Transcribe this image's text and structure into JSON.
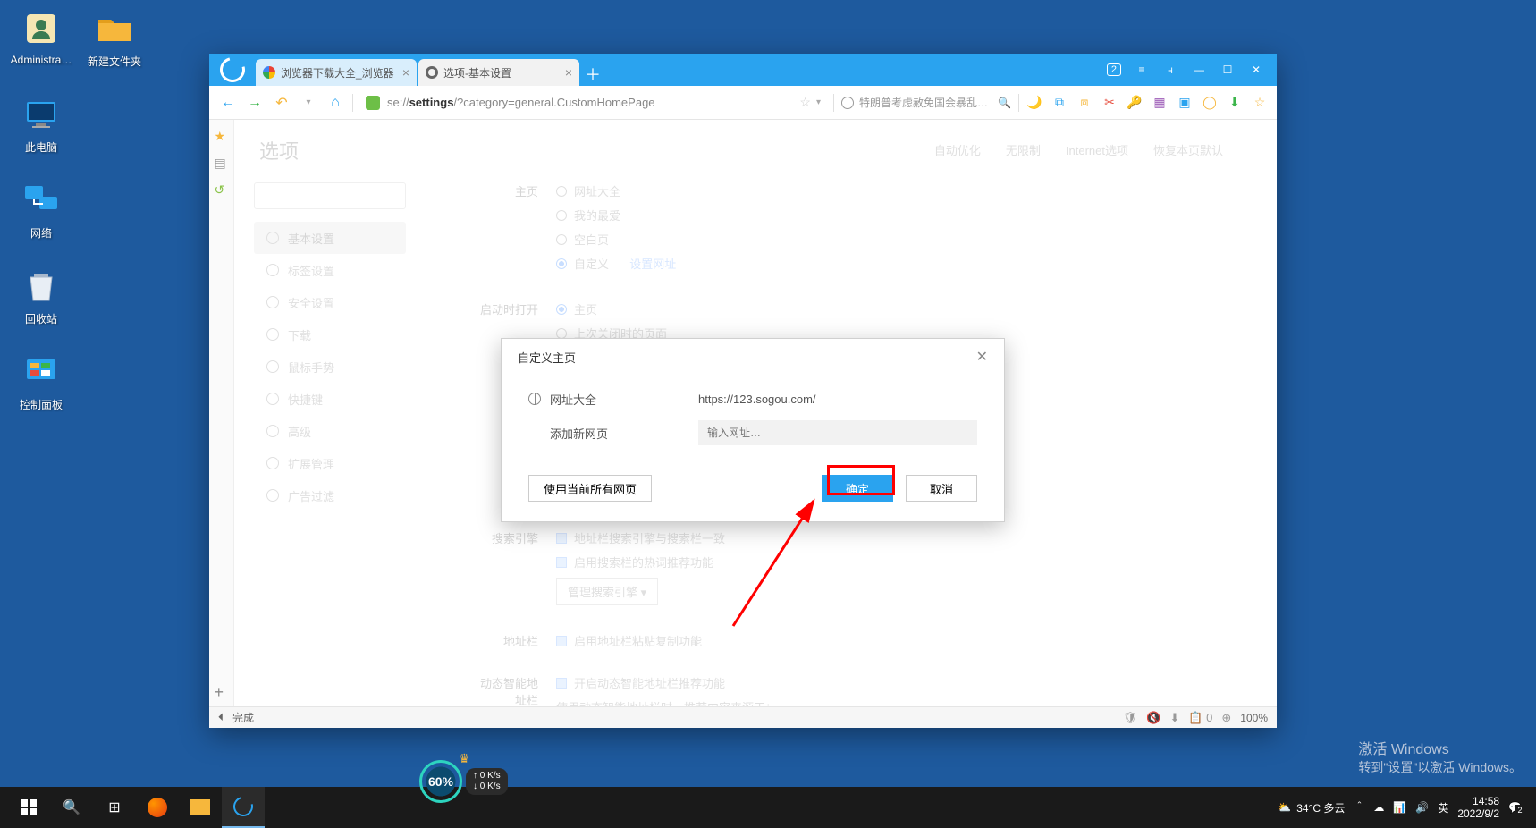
{
  "desktop": {
    "icons": [
      {
        "label": "Administra…",
        "type": "user"
      },
      {
        "label": "新建文件夹",
        "type": "folder"
      },
      {
        "label": "此电脑",
        "type": "pc"
      },
      {
        "label": "网络",
        "type": "network"
      },
      {
        "label": "回收站",
        "type": "recycle"
      },
      {
        "label": "控制面板",
        "type": "control"
      }
    ]
  },
  "browser": {
    "tabs": [
      {
        "title": "浏览器下载大全_浏览器",
        "active": false
      },
      {
        "title": "选项-基本设置",
        "active": true
      }
    ],
    "tab_new_glyph": "＋",
    "win": {
      "count": "2",
      "menu": "≡",
      "ext": "⫞",
      "min": "—",
      "max": "☐",
      "close": "✕"
    },
    "toolbar": {
      "back": "←",
      "fwd": "→",
      "reload": "↻",
      "undo": "↶",
      "dd": "▾",
      "home": "⌂",
      "url_proto": "se://",
      "url_bold": "settings",
      "url_rest": "/?category=general.CustomHomePage",
      "star": "☆",
      "chev": "▾",
      "search_hint": "特朗普考虑赦免国会暴乱参与",
      "search_icon": "🔍",
      "icons": [
        "🌙",
        "⧉",
        "⧈",
        "✂",
        "🔑",
        "▦",
        "▣",
        "◯",
        "⬇",
        "☆"
      ]
    },
    "vbar": {
      "star": "★",
      "book": "▤",
      "history": "↺",
      "add": "+",
      "collapse": "⏴"
    },
    "page": {
      "title": "选项",
      "tabs": [
        "自动优化",
        "无限制",
        "Internet选项",
        "恢复本页默认"
      ],
      "search_placeholder": "",
      "side": [
        {
          "label": "基本设置",
          "active": true
        },
        {
          "label": "标签设置"
        },
        {
          "label": "安全设置"
        },
        {
          "label": "下载"
        },
        {
          "label": "鼠标手势"
        },
        {
          "label": "快捷键"
        },
        {
          "label": "高级"
        },
        {
          "label": "扩展管理"
        },
        {
          "label": "广告过滤"
        }
      ],
      "sections": {
        "homepage": {
          "label": "主页",
          "opts": [
            "网址大全",
            "我的最爱",
            "空白页",
            "自定义"
          ],
          "custom_link": "设置网址"
        },
        "startup": {
          "label": "启动时打开",
          "opts": [
            "主页",
            "上次关闭时的页面"
          ]
        },
        "search": {
          "label": "搜索引擎",
          "chk1": "地址栏搜索引擎与搜索栏一致",
          "chk2": "启用搜索栏的热词推荐功能",
          "manage": "管理搜索引擎 ▾"
        },
        "addrbar": {
          "label": "地址栏",
          "chk": "启用地址栏粘贴复制功能"
        },
        "smart": {
          "label": "动态智能地址栏",
          "chk1": "开启动态智能地址栏推荐功能",
          "chk2": "使用动态智能地址栏时，推荐内容来源于："
        }
      }
    },
    "modal": {
      "title": "自定义主页",
      "row1_label": "网址大全",
      "row1_url": "https://123.sogou.com/",
      "row2_label": "添加新网页",
      "row2_placeholder": "输入网址…",
      "btn_useall": "使用当前所有网页",
      "btn_ok": "确定",
      "btn_cancel": "取消",
      "close": "✕"
    },
    "status": {
      "done": "完成",
      "mute": "🔇",
      "dl": "⬇",
      "ad": "📋 0",
      "zoom_icon": "⊕",
      "zoom": "100%",
      "shield": "🛡"
    }
  },
  "speed": {
    "pct": "60%",
    "up": "0 K/s",
    "down": "0 K/s",
    "crown": "♛"
  },
  "watermark": {
    "l1": "激活 Windows",
    "l2": "转到\"设置\"以激活 Windows。"
  },
  "taskbar": {
    "weather_temp": "34°C 多云",
    "tray_icons": [
      "＾",
      "☁",
      "📊",
      "🔊",
      "英"
    ],
    "time": "14:58",
    "date": "2022/9/2"
  }
}
